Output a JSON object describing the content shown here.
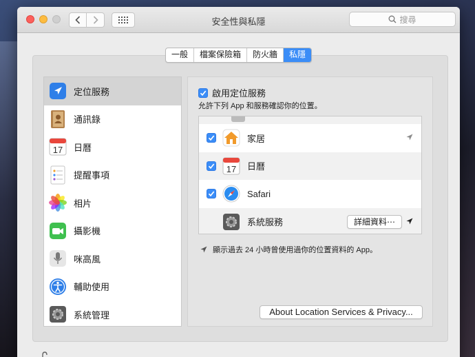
{
  "window": {
    "title": "安全性與私隱",
    "search_placeholder": "搜尋"
  },
  "tabs": [
    {
      "label": "一般",
      "active": false
    },
    {
      "label": "檔案保險箱",
      "active": false
    },
    {
      "label": "防火牆",
      "active": false
    },
    {
      "label": "私隱",
      "active": true
    }
  ],
  "sidebar": {
    "items": [
      {
        "label": "定位服務",
        "icon": "location-services-icon",
        "selected": true
      },
      {
        "label": "通訊錄",
        "icon": "contacts-icon",
        "selected": false
      },
      {
        "label": "日曆",
        "icon": "calendar-icon",
        "selected": false
      },
      {
        "label": "提醒事項",
        "icon": "reminders-icon",
        "selected": false
      },
      {
        "label": "相片",
        "icon": "photos-icon",
        "selected": false
      },
      {
        "label": "攝影機",
        "icon": "camera-icon",
        "selected": false
      },
      {
        "label": "咪高風",
        "icon": "microphone-icon",
        "selected": false
      },
      {
        "label": "輔助使用",
        "icon": "accessibility-icon",
        "selected": false
      },
      {
        "label": "系統管理",
        "icon": "system-admin-icon",
        "selected": false
      }
    ]
  },
  "location": {
    "enable_label": "啟用定位服務",
    "enable_checked": true,
    "description": "允許下列 App 和服務確認你的位置。",
    "apps": [
      {
        "name": "家居",
        "checked": true,
        "recent": true,
        "icon": "home-app-icon"
      },
      {
        "name": "日曆",
        "checked": true,
        "recent": false,
        "icon": "calendar-icon"
      },
      {
        "name": "Safari",
        "checked": true,
        "recent": false,
        "icon": "safari-icon"
      },
      {
        "name": "系統服務",
        "checked": null,
        "recent": true,
        "icon": "system-services-icon",
        "button": "詳細資料⋯"
      }
    ],
    "footnote": "顯示過去 24 小時曾使用過你的位置資料的 App。",
    "about_button": "About Location Services & Privacy..."
  },
  "calendar_day": "17",
  "colors": {
    "accent": "#3b8df7",
    "close": "#fc605c",
    "minimize": "#fdbc40"
  }
}
